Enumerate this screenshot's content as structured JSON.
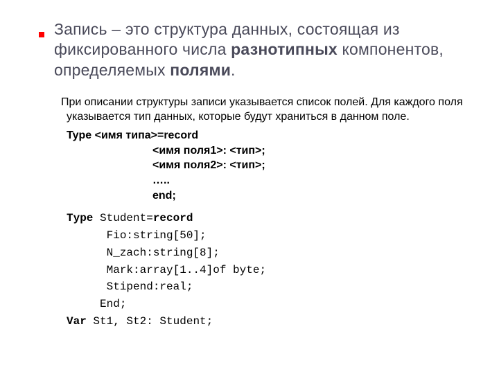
{
  "title": {
    "t1": "Запись – это структура данных, состоящая из фиксированного числа ",
    "b1": "разнотипных",
    "t2": " компонентов, определяемых  ",
    "b2": "полями",
    "t3": "."
  },
  "intro": "При описании структуры записи указывается список полей. Для каждого поля  указывается тип данных, которые будут храниться в данном поле.",
  "syntax": {
    "l1": "Type <имя типа>=record",
    "l2": "<имя поля1>: <тип>;",
    "l3": "<имя поля2>: <тип>;",
    "l4": "…..",
    "l5": "end;"
  },
  "code": {
    "c1a": "Type",
    "c1b": " Student=",
    "c1c": "record",
    "c2": "      Fio:string[50];",
    "c3": "      N_zach:string[8];",
    "c4": "      Mark:array[1..4]of byte;",
    "c5": "      Stipend:real;",
    "c6": "     End;",
    "c7a": "Var",
    "c7b": " St1, St2: Student;"
  }
}
